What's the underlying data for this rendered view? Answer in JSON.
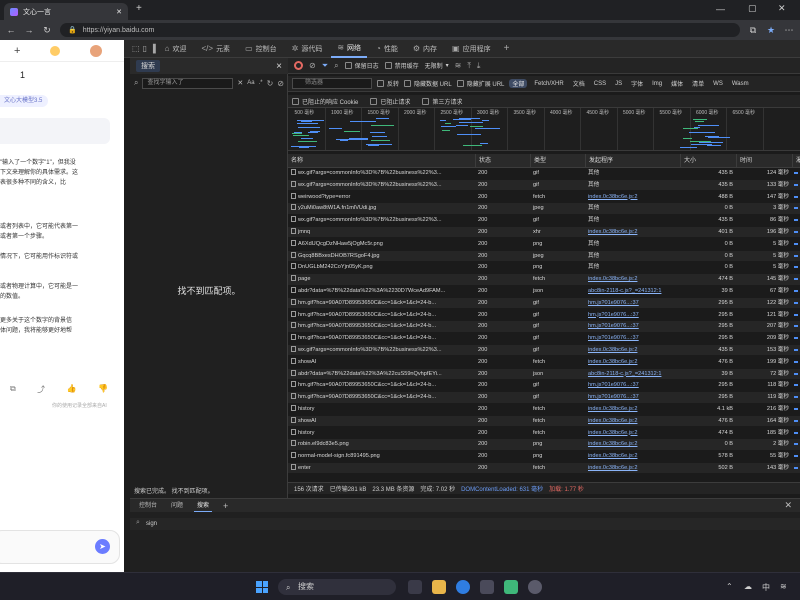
{
  "browser": {
    "tab_title": "文心一言",
    "url": "https://yiyan.baidu.com"
  },
  "page": {
    "top_plus": "+",
    "top_number": "1",
    "model_pill": "文心大模型3.5",
    "paragraphs": [
      "\"输入了一个数字\"1\"，但我没",
      "下文来理解你的具体需求。这",
      "表很多种不同的含义，比",
      "或者列表中，它可能代表第一",
      "或者第一个步骤。",
      "情况下，它可能用作标识符或",
      "或者物理计算中，它可能是一",
      "的数值。",
      "更多关于这个数字的背景信",
      "体问题，我将能够更好地帮"
    ],
    "footer_note": "你的使用记录全部来自AI"
  },
  "devtools": {
    "tabs": [
      {
        "label": "欢迎",
        "icon": "home-icon"
      },
      {
        "label": "元素",
        "icon": "code-icon"
      },
      {
        "label": "控制台",
        "icon": "console-icon"
      },
      {
        "label": "源代码",
        "icon": "bug-icon"
      },
      {
        "label": "网络",
        "icon": "wifi-icon",
        "active": true
      },
      {
        "label": "性能",
        "icon": "performance-icon"
      },
      {
        "label": "内存",
        "icon": "memory-icon"
      },
      {
        "label": "应用程序",
        "icon": "app-icon"
      }
    ],
    "add_tab": "+",
    "search": {
      "title": "搜索",
      "close": "×",
      "placeholder": "查找字输入了",
      "case_label": "Aa",
      "regex_label": ".*",
      "empty_message": "找不到匹配项。",
      "footer": "搜索已完成。 找不到匹配项。"
    },
    "network": {
      "toolbar1": {
        "preserve_log": "保留日志",
        "disable_cache": "禁用缓存",
        "throttle": "无限制"
      },
      "toolbar2": {
        "filter_placeholder": "筛选器",
        "invert": "反转",
        "hide_data_url": "隐藏数据 URL",
        "hide_ext_url": "隐藏扩展 URL",
        "types": [
          "全部",
          "Fetch/XHR",
          "文档",
          "CSS",
          "JS",
          "字体",
          "Img",
          "媒体",
          "清单",
          "WS",
          "Wasm"
        ],
        "selected_type": "全部"
      },
      "toolbar3": {
        "blocked_cookies": "已阻止的响应 Cookie",
        "blocked_requests": "已阻止请求",
        "third_party": "第三方请求"
      },
      "overview_ticks": [
        "500 毫秒",
        "1000 毫秒",
        "1500 毫秒",
        "2000 毫秒",
        "2500 毫秒",
        "3000 毫秒",
        "3500 毫秒",
        "4000 毫秒",
        "4500 毫秒",
        "5000 毫秒",
        "5500 毫秒",
        "6000 毫秒",
        "6500 毫秒"
      ],
      "columns": [
        "名称",
        "状态",
        "类型",
        "发起程序",
        "大小",
        "时间",
        "瀑布"
      ],
      "rows": [
        {
          "name": "wx.gif?args=commonInfo%3D%7B%22business%22%3...",
          "status": "200",
          "type": "gif",
          "initiator": "其他",
          "size": "435 B",
          "time": "124 毫秒"
        },
        {
          "name": "wx.gif?args=commonInfo%3D%7B%22business%22%3...",
          "status": "200",
          "type": "gif",
          "initiator": "其他",
          "size": "435 B",
          "time": "133 毫秒"
        },
        {
          "name": "weirwood?type=error",
          "status": "200",
          "type": "fetch",
          "initiator": "index.0c38bc6e.js:2",
          "size": "488 B",
          "time": "147 毫秒"
        },
        {
          "name": "y2uMi0aw8tW1A.fn1mlVUdi.jpg",
          "status": "200",
          "type": "jpeg",
          "initiator": "其他",
          "size": "0 B",
          "time": "3 毫秒"
        },
        {
          "name": "wx.gif?args=commonInfo%3D%7B%22business%22%3...",
          "status": "200",
          "type": "gif",
          "initiator": "其他",
          "size": "435 B",
          "time": "86 毫秒"
        },
        {
          "name": "jmnq",
          "status": "200",
          "type": "xhr",
          "initiator": "index.0c38bc6e.js:2",
          "size": "401 B",
          "time": "196 毫秒"
        },
        {
          "name": "A6XdUQcgDzNHaw5jOgMc5r.png",
          "status": "200",
          "type": "png",
          "initiator": "其他",
          "size": "0 B",
          "time": "5 毫秒"
        },
        {
          "name": "Gqcq8BBxesDHOB7RSgoF4.jpg",
          "status": "200",
          "type": "jpeg",
          "initiator": "其他",
          "size": "0 B",
          "time": "5 毫秒"
        },
        {
          "name": "DnUGLbM242CoYjn05yK.png",
          "status": "200",
          "type": "png",
          "initiator": "其他",
          "size": "0 B",
          "time": "5 毫秒"
        },
        {
          "name": "page",
          "status": "200",
          "type": "fetch",
          "initiator": "index.0c38bc6e.js:2",
          "size": "474 B",
          "time": "145 毫秒"
        },
        {
          "name": "abdr?data=%7B%22data%22%3A%2230D7WceAd9FAM...",
          "status": "200",
          "type": "json",
          "initiator": "abc8in-2118-c.js?_=241312:1",
          "size": "39 B",
          "time": "67 毫秒"
        },
        {
          "name": "hm.gif?hca=90A07D89953650C&cc=1&ck=1&cl=24-b...",
          "status": "200",
          "type": "gif",
          "initiator": "hm.js?01e9076...:37",
          "size": "295 B",
          "time": "122 毫秒"
        },
        {
          "name": "hm.gif?hca=90A07D89953650C&cc=1&ck=1&cl=24-b...",
          "status": "200",
          "type": "gif",
          "initiator": "hm.js?01e9076...:37",
          "size": "295 B",
          "time": "121 毫秒"
        },
        {
          "name": "hm.gif?hca=90A07D89953650C&cc=1&ck=1&cl=24-b...",
          "status": "200",
          "type": "gif",
          "initiator": "hm.js?01e9076...:37",
          "size": "295 B",
          "time": "207 毫秒"
        },
        {
          "name": "hm.gif?hca=90A07D89953650C&cc=1&ck=1&cl=24-b...",
          "status": "200",
          "type": "gif",
          "initiator": "hm.js?01e9076...:37",
          "size": "295 B",
          "time": "209 毫秒"
        },
        {
          "name": "wx.gif?args=commonInfo%3D%7B%22business%22%3...",
          "status": "200",
          "type": "gif",
          "initiator": "index.0c38bc6e.js:2",
          "size": "435 B",
          "time": "153 毫秒"
        },
        {
          "name": "showAI",
          "status": "200",
          "type": "fetch",
          "initiator": "index.0c38bc6e.js:2",
          "size": "476 B",
          "time": "199 毫秒"
        },
        {
          "name": "abdr?data=%7B%22data%22%3A%22cuS59nQvhpfEYi...",
          "status": "200",
          "type": "json",
          "initiator": "abc8in-2118-c.js?_=241312:1",
          "size": "39 B",
          "time": "72 毫秒"
        },
        {
          "name": "hm.gif?hca=90A07D89953650C&cc=1&ck=1&cl=24-b...",
          "status": "200",
          "type": "gif",
          "initiator": "hm.js?01e9076...:37",
          "size": "295 B",
          "time": "118 毫秒"
        },
        {
          "name": "hm.gif?hca=90A07D89953650C&cc=1&ck=1&cl=24-b...",
          "status": "200",
          "type": "gif",
          "initiator": "hm.js?01e9076...:37",
          "size": "295 B",
          "time": "119 毫秒"
        },
        {
          "name": "history",
          "status": "200",
          "type": "fetch",
          "initiator": "index.0c38bc6e.js:2",
          "size": "4.1 kB",
          "time": "216 毫秒"
        },
        {
          "name": "showAI",
          "status": "200",
          "type": "fetch",
          "initiator": "index.0c38bc6e.js:2",
          "size": "476 B",
          "time": "164 毫秒"
        },
        {
          "name": "history",
          "status": "200",
          "type": "fetch",
          "initiator": "index.0c38bc6e.js:2",
          "size": "474 B",
          "time": "185 毫秒"
        },
        {
          "name": "robin.el9dc83e5.png",
          "status": "200",
          "type": "png",
          "initiator": "index.0c38bc6e.js:2",
          "size": "0 B",
          "time": "2 毫秒"
        },
        {
          "name": "normal-model-sign.fc891495.png",
          "status": "200",
          "type": "png",
          "initiator": "index.0c38bc6e.js:2",
          "size": "578 B",
          "time": "55 毫秒"
        },
        {
          "name": "enter",
          "status": "200",
          "type": "fetch",
          "initiator": "index.0c38bc6e.js:2",
          "size": "502 B",
          "time": "143 毫秒"
        }
      ],
      "status": {
        "requests": "156 次请求",
        "transferred": "已传输281 kB",
        "resources": "23.3 MB 条资源",
        "finish": "完成: 7.02 秒",
        "dcl": "DOMContentLoaded: 631 毫秒",
        "load": "加载: 1.77 秒"
      }
    },
    "drawer": {
      "tabs": [
        "控制台",
        "问题",
        "搜索"
      ],
      "active": "搜索",
      "add": "+",
      "query": "sign"
    }
  },
  "taskbar": {
    "search_label": "搜索",
    "ime": "中"
  }
}
